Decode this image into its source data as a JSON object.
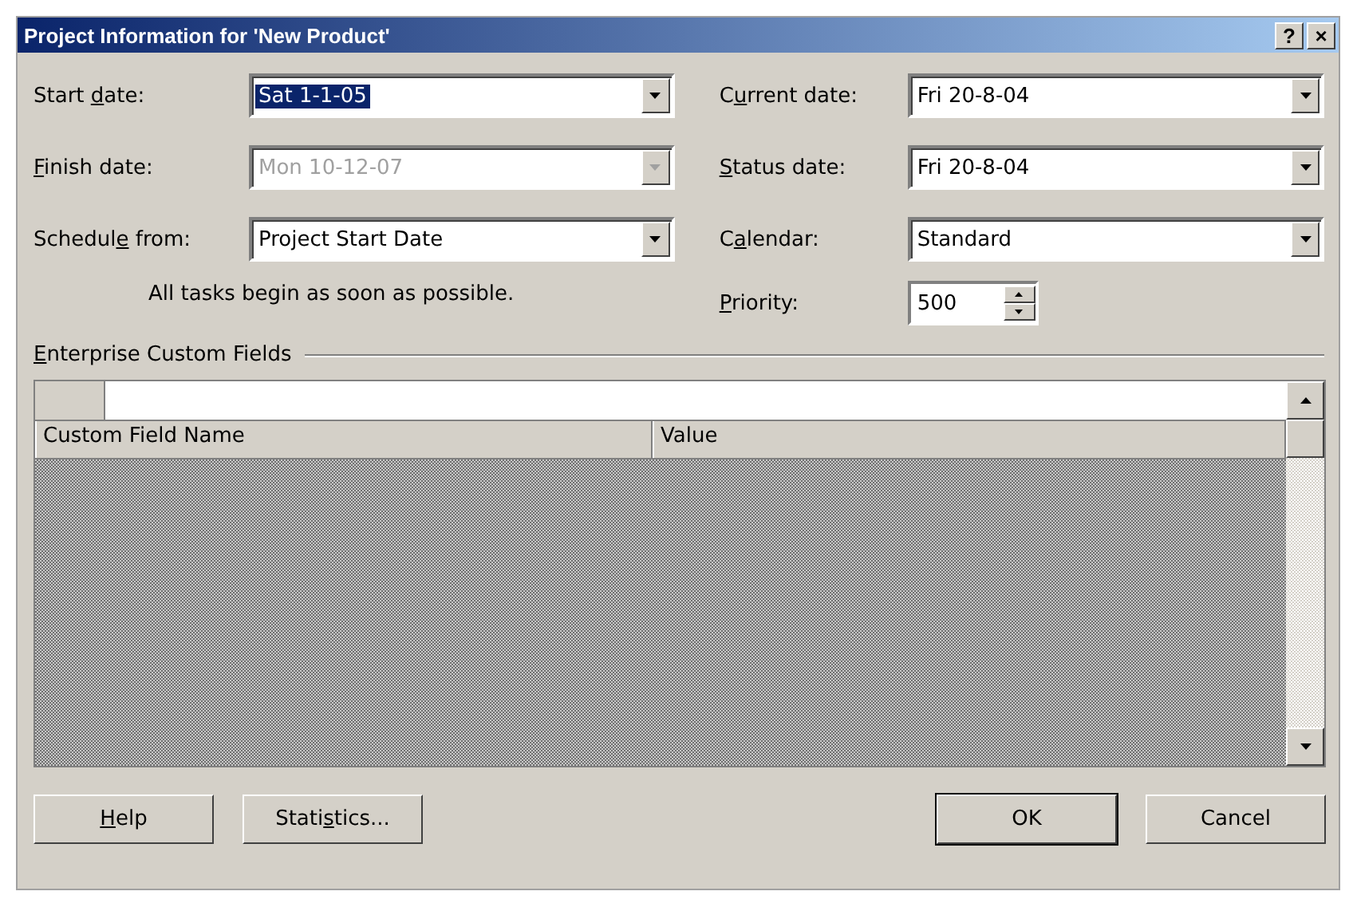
{
  "window": {
    "title": "Project Information for 'New Product'",
    "buttons": [
      "?",
      "×"
    ]
  },
  "left_fields": [
    {
      "label": "Start date:",
      "value": "Sat 1-1-05",
      "disabled": false,
      "selected": true
    },
    {
      "label": "Finish date:",
      "value": "Mon 10-12-07",
      "disabled": true,
      "selected": false
    },
    {
      "label": "Schedule from:",
      "value": "Project Start Date",
      "disabled": false,
      "selected": false
    }
  ],
  "note": "All tasks begin as soon as possible.",
  "right_fields": [
    {
      "label": "Current date:",
      "value": "Fri 20-8-04"
    },
    {
      "label": "Status date:",
      "value": "Fri 20-8-04"
    },
    {
      "label": "Calendar:",
      "value": "Standard"
    }
  ],
  "priority": {
    "label": "Priority:",
    "value": "500"
  },
  "group": {
    "label": "Enterprise Custom Fields"
  },
  "table": {
    "columns": [
      "Custom Field Name",
      "Value"
    ]
  },
  "buttons": [
    {
      "label": "Help",
      "default": false
    },
    {
      "label": "Statistics...",
      "default": false
    },
    {
      "label": "OK",
      "default": true
    },
    {
      "label": "Cancel",
      "default": false
    }
  ]
}
